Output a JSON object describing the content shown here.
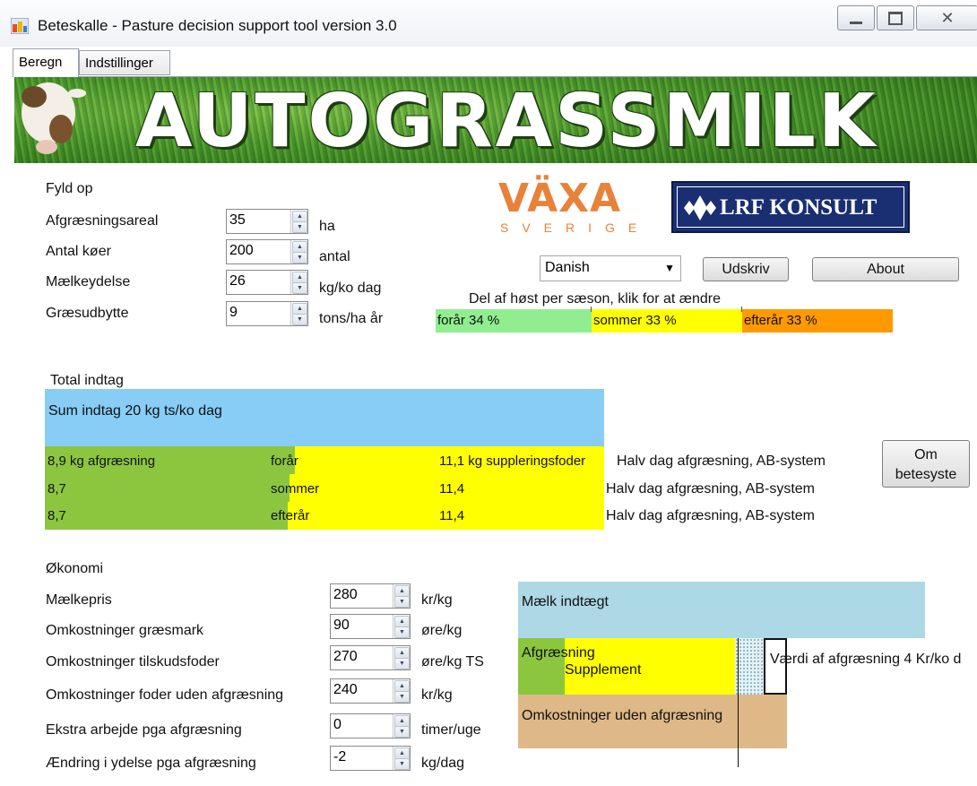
{
  "window": {
    "title": "Beteskalle - Pasture decision support tool version 3.0"
  },
  "tabs": [
    {
      "label": "Beregn"
    },
    {
      "label": "Indstillinger"
    }
  ],
  "banner": {
    "title": "AUTOGRASSMILK"
  },
  "logos": {
    "vaxa_top": "VÄXA",
    "vaxa_bottom": "SVERIGE",
    "lrf": "LRF KONSULT"
  },
  "fill": {
    "heading": "Fyld op",
    "fields": [
      {
        "label": "Afgræsningsareal",
        "value": "35",
        "unit": "ha"
      },
      {
        "label": "Antal køer",
        "value": "200",
        "unit": "antal"
      },
      {
        "label": "Mælkeydelse",
        "value": "26",
        "unit": "kg/ko dag"
      },
      {
        "label": "Græsudbytte",
        "value": "9",
        "unit": "tons/ha år"
      }
    ]
  },
  "language": {
    "selected": "Danish"
  },
  "buttons": {
    "print": "Udskriv",
    "about": "About",
    "om_line1": "Om",
    "om_line2": "betesyste"
  },
  "season": {
    "caption": "Del af høst per sæson, klik for at ændre",
    "spring": "forår 34 %",
    "summer": "sommer 33 %",
    "autumn": "efterår 33 %",
    "spring_share": 34,
    "summer_share": 33,
    "autumn_share": 33
  },
  "intake": {
    "heading": "Total indtag",
    "sum": "Sum indtag 20 kg ts/ko dag",
    "rows": [
      {
        "grazing": "8,9 kg afgræsning",
        "season": "forår",
        "supplement": "11,1 kg suppleringsfoder",
        "system": "Halv dag afgræsning, AB-system"
      },
      {
        "grazing": "8,7",
        "season": "sommer",
        "supplement": "11,4",
        "system": "Halv dag afgræsning, AB-system"
      },
      {
        "grazing": "8,7",
        "season": "efterår",
        "supplement": "11,4",
        "system": "Halv dag afgræsning, AB-system"
      }
    ]
  },
  "economy": {
    "heading": "Økonomi",
    "fields": [
      {
        "label": "Mælkepris",
        "value": "280",
        "unit": "kr/kg"
      },
      {
        "label": "Omkostninger græsmark",
        "value": "90",
        "unit": "øre/kg"
      },
      {
        "label": "Omkostninger tilskudsfoder",
        "value": "270",
        "unit": "øre/kg TS"
      },
      {
        "label": "Omkostninger foder uden  afgræsning",
        "value": "240",
        "unit": "kr/kg"
      },
      {
        "label": "Ekstra arbejde pga afgræsning",
        "value": "0",
        "unit": "timer/uge"
      },
      {
        "label": "Ændring i ydelse pga afgræsning",
        "value": "-2",
        "unit": "kg/dag"
      }
    ]
  },
  "econ_chart": {
    "milk_income": "Mælk indtægt",
    "grazing": "Afgræsning",
    "supplement": "Supplement",
    "value_text": "Værdi af afgræsning 4 Kr/ko d",
    "without_grazing": "Omkostninger uden afgræsning"
  },
  "colors": {
    "green": "#8cc63f",
    "yellow": "#ffff00",
    "blue": "#87cdf5",
    "orange": "#ff9900",
    "light_green": "#90ee90",
    "tan": "#deb887",
    "lightblue": "#add8e6"
  }
}
